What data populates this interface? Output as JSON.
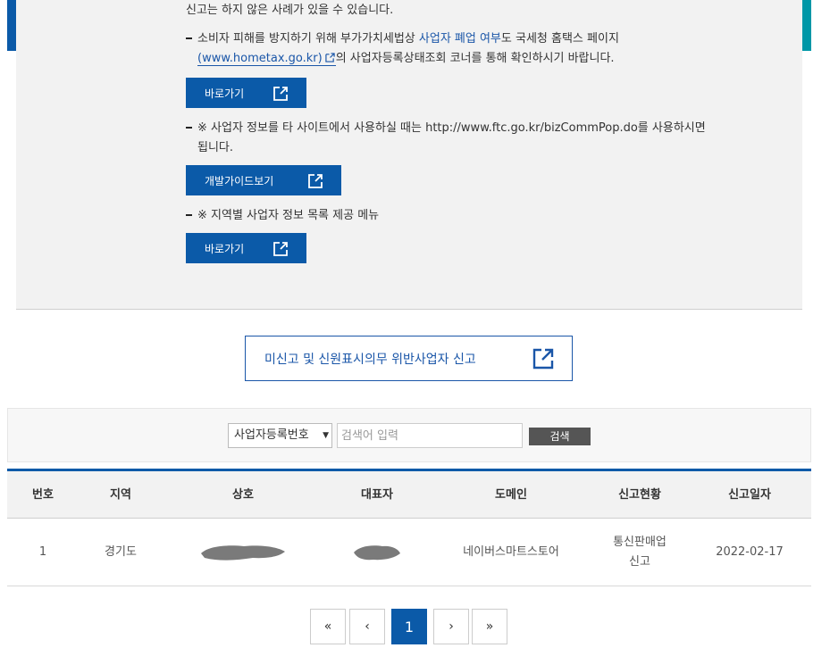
{
  "notice": {
    "line_top": "신고는 하지 않은 사례가 있을 수 있습니다.",
    "item1_pre": "소비자 피해를 방지하기 위해 부가가치세법상 ",
    "item1_hl": "사업자 폐업 여부",
    "item1_post": "도 국세청 홈택스 페이지",
    "item1_link": "(www.hometax.go.kr)",
    "item1_tail": "의 사업자등록상태조회 코너를 통해 확인하시기 바랍니다.",
    "btn1": "바로가기",
    "item2_line1": "※ 사업자 정보를 타 사이트에서 사용하실 때는 http://www.ftc.go.kr/bizCommPop.do를 사용하시면",
    "item2_line2": "됩니다.",
    "btn2": "개발가이드보기",
    "item3": "※ 지역별 사업자 정보 목록 제공 메뉴",
    "btn3": "바로가기"
  },
  "report_button": "미신고 및 신원표시의무 위반사업자 신고",
  "search": {
    "select_value": "사업자등록번호",
    "placeholder": "검색어 입력",
    "button": "검색"
  },
  "table": {
    "headers": [
      "번호",
      "지역",
      "상호",
      "대표자",
      "도메인",
      "신고현황",
      "신고일자"
    ],
    "rows": [
      {
        "no": "1",
        "region": "경기도",
        "domain": "네이버스마트스토어",
        "status_line1": "통신판매업",
        "status_line2": "신고",
        "date": "2022-02-17"
      }
    ]
  },
  "pagination": {
    "first": "«",
    "prev": "‹",
    "current": "1",
    "next": "›",
    "last": "»"
  },
  "colors": {
    "primary": "#0b5aa8",
    "teal": "#0097a7",
    "panel_bg": "#f2f2f2",
    "search_btn": "#555555"
  }
}
